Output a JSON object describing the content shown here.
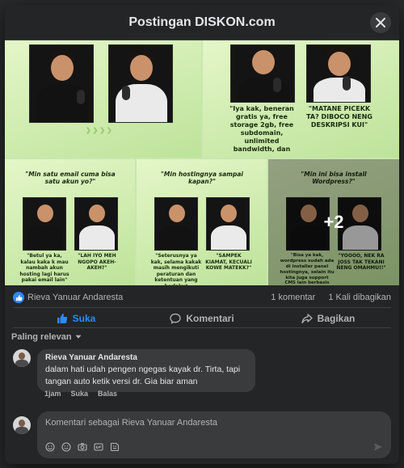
{
  "dialog": {
    "title": "Postingan DISKON.com"
  },
  "media": {
    "tiles": [
      {
        "caption": ""
      },
      {
        "caption": "\"Iya kak, beneran gratis ya, free storage 2gb, free subdomain, unlimited bandwidth, dan",
        "caption_right": "\"MATANE PICEKK TA? DIBOCO NENG DESKRIPSI KUI\""
      },
      {
        "question": "\"Min satu email cuma bisa satu akun yo?\"",
        "left": "\"Betul ya ka, kalau kaka k mau nambah akun hosting lagi harus pakai email lain\"",
        "right": "\"LAH IYO MEH NGOPO AKEH-AKEH?\""
      },
      {
        "question": "\"Min hostingnya sampai kapan?\"",
        "left": "\"Seterusnya ya kak, selama kakak masih mengikuti peraturan dan ketentuan yang berlaku\"",
        "right": "\"SAMPEK KIAMAT, KECUALI KOWE MATEKK?\""
      },
      {
        "question": "\"Min ini bisa install Wordpress?\"",
        "left": "\"Bisa ya kak, wordpress sudah ada di installer panel hostingnya, selain itu kita juga support CMS lain berbasis HTML, PHP, dan MySQL selama",
        "right": "\"YOOOO, NEK RA JOSS TAK TEKANI NENG OMAHMU!!\""
      }
    ],
    "more_count": "+2"
  },
  "stats": {
    "liker": "Rieva Yanuar Andaresta",
    "comments": "1 komentar",
    "shares": "1 Kali dibagikan"
  },
  "actions": {
    "like": "Suka",
    "comment": "Komentari",
    "share": "Bagikan"
  },
  "sort": {
    "label": "Paling relevan"
  },
  "comment": {
    "author": "Rieva Yanuar Andaresta",
    "text": "dalam hati udah pengen ngegas kayak dr. Tirta, tapi tangan auto ketik versi dr. Gia biar aman",
    "time": "1jam",
    "like": "Suka",
    "reply": "Balas"
  },
  "composer": {
    "placeholder": "Komentari sebagai Rieva Yanuar Andaresta"
  },
  "colors": {
    "accent": "#2d88ff",
    "dialog_bg": "#242526",
    "bubble_bg": "#3a3b3c",
    "tile_green": "#bde39a"
  },
  "icons": [
    "close-icon",
    "like-icon",
    "comment-icon",
    "share-icon",
    "chevron-down-icon",
    "avatar",
    "send-icon"
  ]
}
